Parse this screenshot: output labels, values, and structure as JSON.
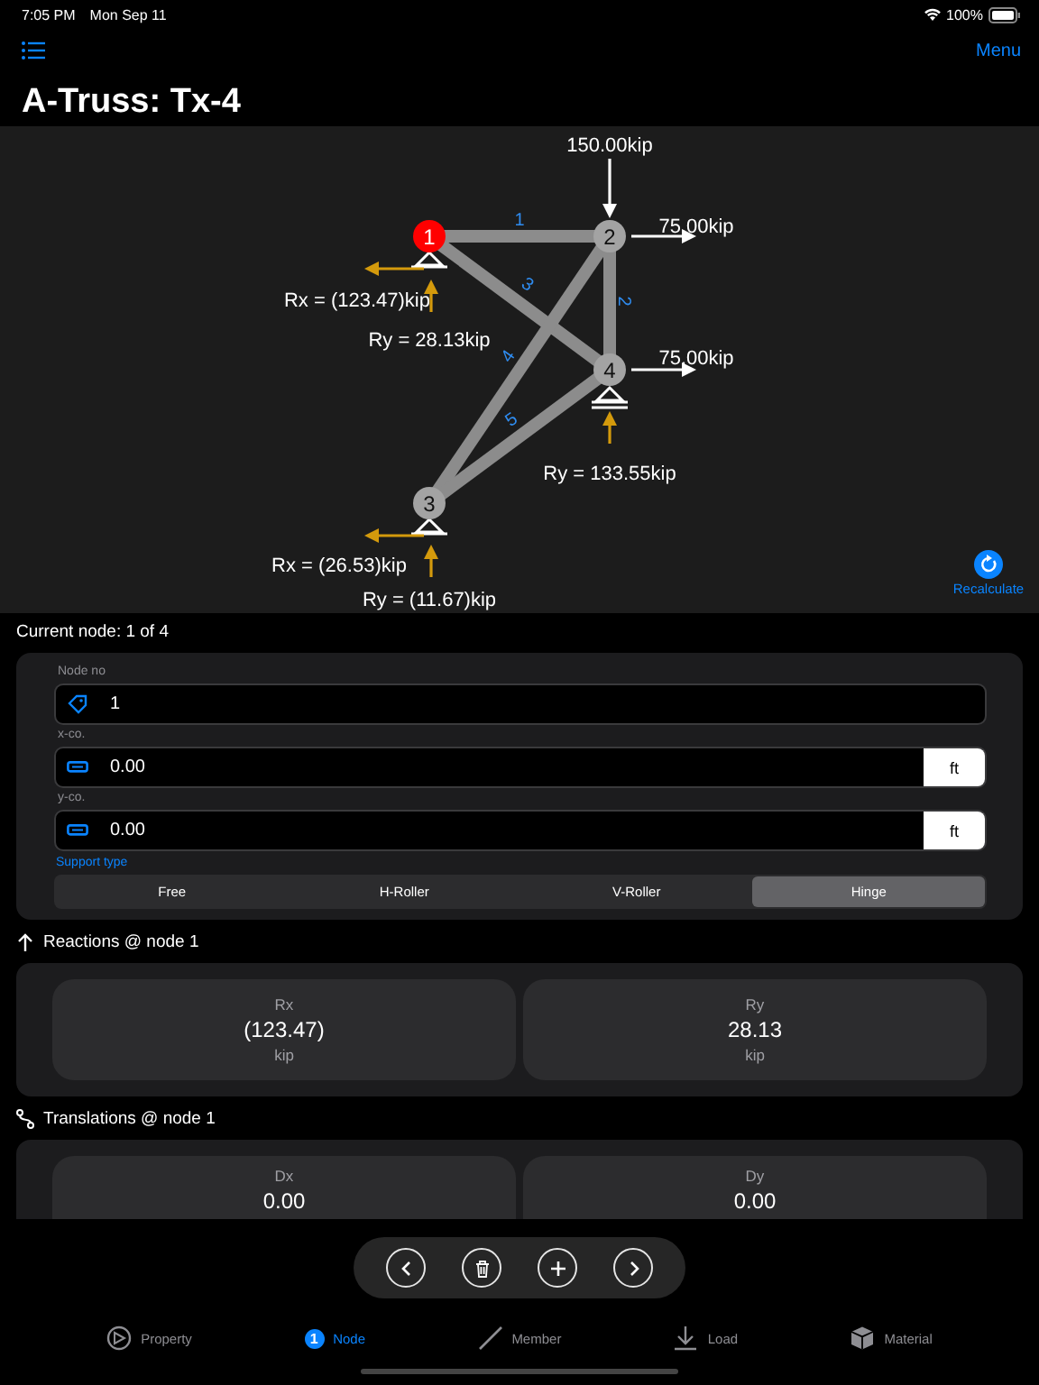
{
  "status_bar": {
    "time": "7:05 PM",
    "date": "Mon Sep 11",
    "battery": "100%"
  },
  "nav": {
    "menu": "Menu",
    "title": "A-Truss: Tx-4"
  },
  "diagram": {
    "nodes": [
      {
        "label": "1",
        "selected": true
      },
      {
        "label": "2",
        "selected": false
      },
      {
        "label": "4",
        "selected": false
      },
      {
        "label": "3",
        "selected": false
      }
    ],
    "members": [
      {
        "label": "1"
      },
      {
        "label": "2"
      },
      {
        "label": "3"
      },
      {
        "label": "4"
      },
      {
        "label": "5"
      }
    ],
    "loads": [
      {
        "text": "150.00kip"
      },
      {
        "text": "75.00kip"
      },
      {
        "text": "75.00kip"
      }
    ],
    "reactions": [
      {
        "text": "Rx = (123.47)kip"
      },
      {
        "text": "Ry = 28.13kip"
      },
      {
        "text": "Ry = 133.55kip"
      },
      {
        "text": "Rx = (26.53)kip"
      },
      {
        "text": "Ry = (11.67)kip"
      }
    ],
    "recalculate": "Recalculate"
  },
  "current_node": "Current node: 1 of 4",
  "form": {
    "fields": [
      {
        "label": "Node no",
        "value": "1"
      },
      {
        "label": "x-co.",
        "value": "0.00",
        "unit": "ft"
      },
      {
        "label": "y-co.",
        "value": "0.00",
        "unit": "ft"
      }
    ],
    "support_label": "Support type",
    "support_types": [
      {
        "label": "Free",
        "selected": false
      },
      {
        "label": "H-Roller",
        "selected": false
      },
      {
        "label": "V-Roller",
        "selected": false
      },
      {
        "label": "Hinge",
        "selected": true
      }
    ]
  },
  "reactions": {
    "heading": "Reactions @ node 1",
    "cards": [
      {
        "label": "Rx",
        "value": "(123.47)",
        "unit": "kip"
      },
      {
        "label": "Ry",
        "value": "28.13",
        "unit": "kip"
      }
    ]
  },
  "translations": {
    "heading": "Translations @ node 1",
    "cards": [
      {
        "label": "Dx",
        "value": "0.00"
      },
      {
        "label": "Dy",
        "value": "0.00"
      }
    ]
  },
  "tabs": [
    {
      "label": "Property",
      "selected": false
    },
    {
      "label": "Node",
      "selected": true,
      "badge": "1"
    },
    {
      "label": "Member",
      "selected": false
    },
    {
      "label": "Load",
      "selected": false
    },
    {
      "label": "Material",
      "selected": false
    }
  ]
}
